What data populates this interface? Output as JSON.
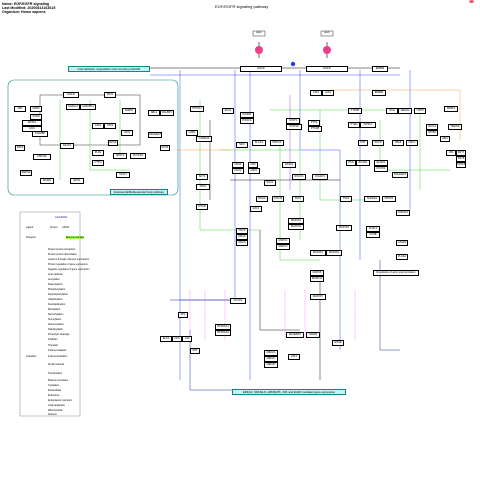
{
  "header": {
    "name": "Name: EGF/EGFR signaling",
    "modified": "Last Modified: 20200813163615",
    "organism": "Organism: Homo sapiens"
  },
  "title": "EGF/EGFR signaling pathway",
  "ligands": [
    "EGF",
    "EGF"
  ],
  "receptors": [
    "EGFR",
    "EGFR",
    "ERBB2"
  ],
  "bands": {
    "internalization": "Internalization, degradation and recycling of EGFR",
    "endosome": "Endosomal/Multivesicular body pathway",
    "nucleus": "ERK1/2, SRF/ELK, p38/MAPK, JNK and EGFR mediated gene expression",
    "transcription": "Regulation of actin polymerization"
  },
  "nodes": {
    "left": [
      "CBL",
      "GRB2",
      "STAM",
      "EPS15",
      "HGS",
      "STAMBP",
      "SH3GL2",
      "SH3KBP1",
      "ARF6",
      "ASAP1",
      "PLD1",
      "USP6NL",
      "CAV1",
      "CAV2",
      "RAB5A",
      "EPS8",
      "SPRY2",
      "VAV1",
      "PLSCR1",
      "EGFR",
      "SNX1",
      "ABL1",
      "ARHGEF7",
      "SOS1",
      "RALBP1",
      "REPS2",
      "AP2M1",
      "EPN1",
      "CTTN",
      "STAT1"
    ],
    "center": [
      "PTPN11",
      "GAB1",
      "SHC1",
      "SRC",
      "PIK3R1",
      "PIK3CA",
      "PLCG1",
      "PRKCA",
      "NCK1",
      "NCK2",
      "CRK",
      "CRKL",
      "RASA1",
      "STAT3",
      "STAT5A",
      "JAK1",
      "JAK2",
      "PTK2",
      "PTK2B",
      "CAMK2A",
      "RAF1",
      "MAP2K1",
      "MAP2K2",
      "MAPK1",
      "MAPK3",
      "MAP3K1",
      "MAP3K2",
      "MAP4K1",
      "MAPK8",
      "MAPK14",
      "MAP2K7",
      "SP1",
      "ELK1",
      "FOS",
      "JUN",
      "SRF",
      "RPS6KA1",
      "RPS6KA3",
      "MEF2A",
      "MEF2C",
      "MEF2D",
      "ATF1",
      "CREB1",
      "EIF4EBP1",
      "EIF4E",
      "KRAS",
      "HRAS",
      "NRAS",
      "RAC1",
      "RHOA",
      "CDC42",
      "PAK1",
      "ROCK1",
      "IQGAP1",
      "AKT1",
      "MTOR",
      "PDK1",
      "FOXO1"
    ],
    "right": [
      "ERBB2",
      "PTPRR",
      "PTEN",
      "INPPL1",
      "ITCH",
      "NEDD4",
      "USP8",
      "PEBP1",
      "MT1",
      "SOCS",
      "CBLB",
      "CBLC",
      "AP2A1",
      "AP2B1",
      "ABI1",
      "NEDD8",
      "PXN",
      "BCAR1",
      "ELMO1",
      "DOCK1",
      "ARHGEF6",
      "VIM",
      "KRT7",
      "KRT8",
      "KRT18",
      "TNK2",
      "SH2D2A",
      "PRKD1",
      "FOSL1",
      "FOSB",
      "CASP3",
      "PLCE1",
      "CDKN1A"
    ]
  },
  "legend": {
    "title": "LEGEND",
    "items": [
      "Ligand",
      "Protein",
      "mRNA",
      "Receptor",
      "Enzyme complex",
      "Protein protein interaction",
      "Protein protein dissociation",
      "Leads to through unknown mechanism",
      "Protein regulation of gene expression",
      "Negative regulation of gene expression",
      "Auto catalysis",
      "Acetylation",
      "Deacetylation",
      "Phosphorylation",
      "Dephosphorylation",
      "Ubiquitination",
      "Deubiquitination",
      "Methylation",
      "Demethylation",
      "Sumoylation",
      "Desumoylation",
      "Palmitoylation",
      "Proteolytic cleavage",
      "Inhibition",
      "Transport",
      "Induced catalysis",
      "Activation",
      "Induced activation",
      "Small molecule",
      "Translocation",
      "Plasma membrane",
      "Cytoplasm",
      "Extracellular",
      "Endosome",
      "Endoplasmic reticulum",
      "Golgi apparatus",
      "Mitochondrion",
      "Nucleus"
    ]
  }
}
